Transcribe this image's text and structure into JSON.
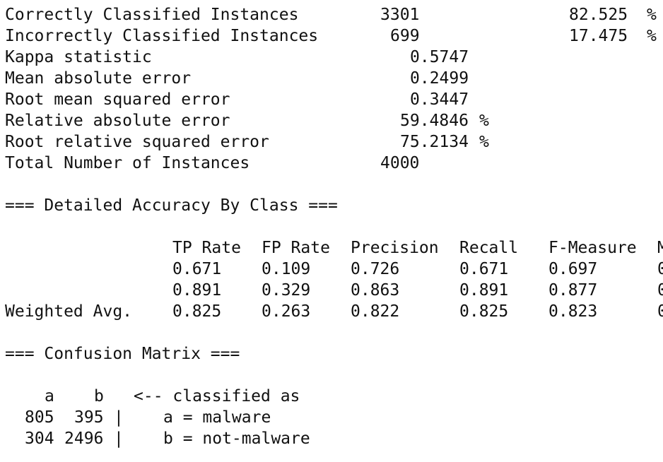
{
  "summary": {
    "rows": [
      {
        "label": "Correctly Classified Instances",
        "value": "3301",
        "percent": "82.525",
        "unit": "%"
      },
      {
        "label": "Incorrectly Classified Instances",
        "value": "699",
        "percent": "17.475",
        "unit": "%"
      },
      {
        "label": "Kappa statistic",
        "value": "0.5747"
      },
      {
        "label": "Mean absolute error",
        "value": "0.2499"
      },
      {
        "label": "Root mean squared error",
        "value": "0.3447"
      },
      {
        "label": "Relative absolute error",
        "value": "59.4846",
        "unit": "%"
      },
      {
        "label": "Root relative squared error",
        "value": "75.2134",
        "unit": "%"
      },
      {
        "label": "Total Number of Instances",
        "value": "4000"
      }
    ]
  },
  "accuracy": {
    "heading": "=== Detailed Accuracy By Class ===",
    "headers": [
      "TP Rate",
      "FP Rate",
      "Precision",
      "Recall",
      "F-Measure",
      "M"
    ],
    "rows": [
      {
        "label": "",
        "cells": [
          "0.671",
          "0.109",
          "0.726",
          "0.671",
          "0.697",
          "0"
        ]
      },
      {
        "label": "",
        "cells": [
          "0.891",
          "0.329",
          "0.863",
          "0.891",
          "0.877",
          "0"
        ]
      },
      {
        "label": "Weighted Avg.",
        "cells": [
          "0.825",
          "0.263",
          "0.822",
          "0.825",
          "0.823",
          "0"
        ]
      }
    ]
  },
  "confusion": {
    "heading": "=== Confusion Matrix ===",
    "col_a": "a",
    "col_b": "b",
    "arrow": "<-- classified as",
    "rows": [
      {
        "a": "805",
        "b": "395",
        "sep": "|",
        "legend": "a = malware"
      },
      {
        "a": "304",
        "b": "2496",
        "sep": "|",
        "legend": "b = not-malware"
      }
    ]
  }
}
